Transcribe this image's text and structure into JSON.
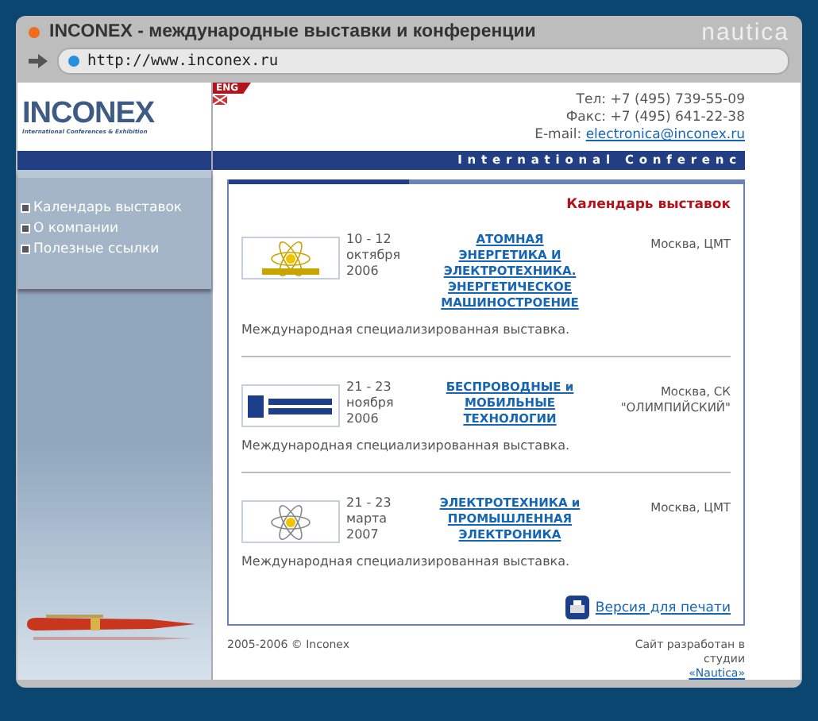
{
  "window": {
    "title": "INCONEX - международные выставки и конференции",
    "brand": "nautica",
    "url": "http://www.inconex.ru"
  },
  "header": {
    "logo": "INCONEX",
    "logo_subtitle": "International Conferences & Exhibition",
    "language": "ENG",
    "phone": "Тел: +7 (495) 739-55-09",
    "fax": "Факс: +7 (495) 641-22-38",
    "email_label": "E-mail:",
    "email": "electronica@inconex.ru"
  },
  "band": "International Conferenc",
  "sidebar": {
    "items": [
      "Календарь выставок",
      "О компании",
      "Полезные ссылки"
    ]
  },
  "calendar": {
    "title": "Календарь выставок",
    "events": [
      {
        "kind": "atom-text",
        "dates": "10 - 12",
        "month": "октября",
        "year": "2006",
        "name": "АТОМНАЯ ЭНЕРГЕТИКА И ЭЛЕКТРОТЕХНИКА. ЭНЕРГЕТИЧЕСКОЕ МАШИНОСТРОЕНИЕ",
        "place": "Москва, ЦМТ",
        "description": "Международная специализированная выставка."
      },
      {
        "kind": "mobile",
        "dates": "21 - 23",
        "month": "ноября",
        "year": "2006",
        "name": "БЕСПРОВОДНЫЕ и МОБИЛЬНЫЕ ТЕХНОЛОГИИ",
        "place": "Москва, СК \"ОЛИМПИЙСКИЙ\"",
        "description": "Международная специализированная выставка."
      },
      {
        "kind": "atom",
        "dates": "21 - 23",
        "month": "марта",
        "year": "2007",
        "name": "ЭЛЕКТРОТЕХНИКА и ПРОМЫШЛЕННАЯ ЭЛЕКТРОНИКА",
        "place": "Москва, ЦМТ",
        "description": "Международная специализированная выставка."
      }
    ],
    "print_link": "Версия для печати"
  },
  "footer": {
    "copyright": "2005-2006 © Inconex",
    "credit": "Сайт разработан в студии",
    "studio": "«Nautica»"
  }
}
